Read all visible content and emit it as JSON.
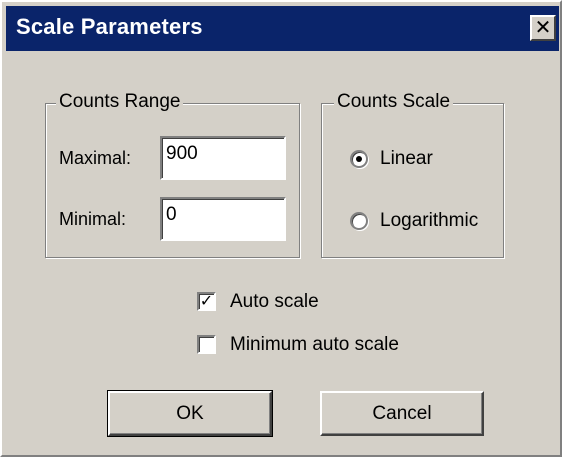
{
  "window": {
    "title": "Scale Parameters",
    "close_glyph": "✕"
  },
  "counts_range": {
    "label": "Counts Range",
    "maximal_label": "Maximal:",
    "maximal_value": "900",
    "minimal_label": "Minimal:",
    "minimal_value": "0"
  },
  "counts_scale": {
    "label": "Counts Scale",
    "options": [
      {
        "label": "Linear",
        "selected": true
      },
      {
        "label": "Logarithmic",
        "selected": false
      }
    ]
  },
  "checkboxes": {
    "auto_scale": {
      "label": "Auto scale",
      "checked": true,
      "glyph": "✓"
    },
    "minimum_auto_scale": {
      "label": "Minimum auto scale",
      "checked": false
    }
  },
  "buttons": {
    "ok": "OK",
    "cancel": "Cancel"
  },
  "colors": {
    "titlebar": "#0a246a",
    "face": "#d4d0c8"
  }
}
